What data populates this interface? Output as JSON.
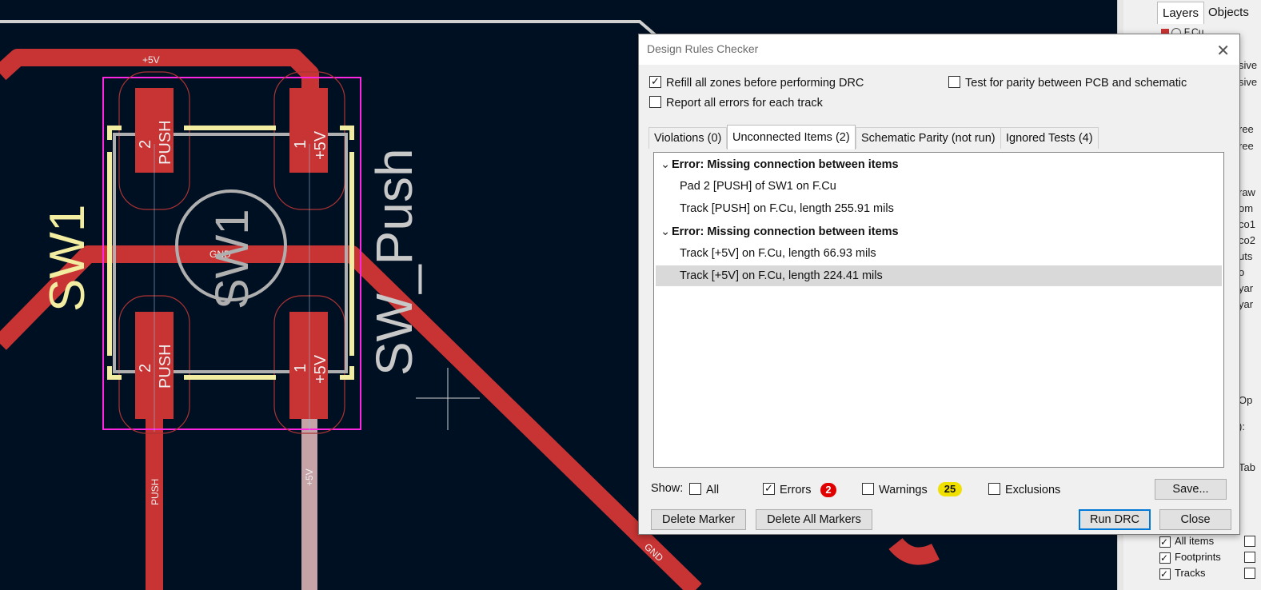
{
  "canvas": {
    "net_labels": [
      "+5V",
      "GND",
      "PUSH",
      "+5V",
      "GND"
    ],
    "pad_labels": [
      {
        "num": "2",
        "net": "PUSH"
      },
      {
        "num": "1",
        "net": "+5V"
      },
      {
        "num": "2",
        "net": "PUSH"
      },
      {
        "num": "1",
        "net": "+5V"
      }
    ],
    "refdes": "SW1",
    "value": "SW_Push",
    "fab_ref": "SW1",
    "colors": {
      "background": "#001023",
      "copper": "#c83434",
      "silk": "#f2eda1",
      "courtyard": "#ff26e2",
      "fab": "#afafaf"
    }
  },
  "right_panel": {
    "tabs": [
      "Layers",
      "Objects"
    ],
    "layer": "F.Cu",
    "snippets": [
      "sive",
      "sive",
      "ree",
      "ree",
      "raw",
      "om",
      "co1",
      "co2",
      "uts",
      "o",
      "yar",
      "yar",
      "Op",
      "):",
      "Tab"
    ],
    "visibility": [
      {
        "label": "All items",
        "checked": true
      },
      {
        "label": "Footprints",
        "checked": true
      },
      {
        "label": "Tracks",
        "checked": true
      }
    ]
  },
  "dialog": {
    "title": "Design Rules Checker",
    "options": {
      "refill": {
        "label": "Refill all zones before performing DRC",
        "checked": true
      },
      "parity": {
        "label": "Test for parity between PCB and schematic",
        "checked": false
      },
      "report_all": {
        "label": "Report all errors for each track",
        "checked": false
      }
    },
    "tabs": [
      {
        "label": "Violations (0)",
        "active": false
      },
      {
        "label": "Unconnected Items (2)",
        "active": true
      },
      {
        "label": "Schematic Parity (not run)",
        "active": false
      },
      {
        "label": "Ignored Tests (4)",
        "active": false
      }
    ],
    "groups": [
      {
        "header": "Error: Missing connection between items",
        "items": [
          "Pad 2 [PUSH] of SW1 on F.Cu",
          "Track [PUSH] on F.Cu, length 255.91 mils"
        ]
      },
      {
        "header": "Error: Missing connection between items",
        "items": [
          "Track [+5V] on F.Cu, length 66.93 mils",
          "Track [+5V] on F.Cu, length 224.41 mils"
        ]
      }
    ],
    "show": {
      "label": "Show:",
      "all": {
        "label": "All",
        "checked": false
      },
      "errors": {
        "label": "Errors",
        "checked": true,
        "count": "2",
        "color": "#e00000"
      },
      "warnings": {
        "label": "Warnings",
        "checked": false,
        "count": "25",
        "color": "#f0e000"
      },
      "exclusions": {
        "label": "Exclusions",
        "checked": false
      }
    },
    "buttons": {
      "save": "Save...",
      "delete_marker": "Delete Marker",
      "delete_all": "Delete All Markers",
      "run": "Run DRC",
      "close": "Close"
    }
  }
}
